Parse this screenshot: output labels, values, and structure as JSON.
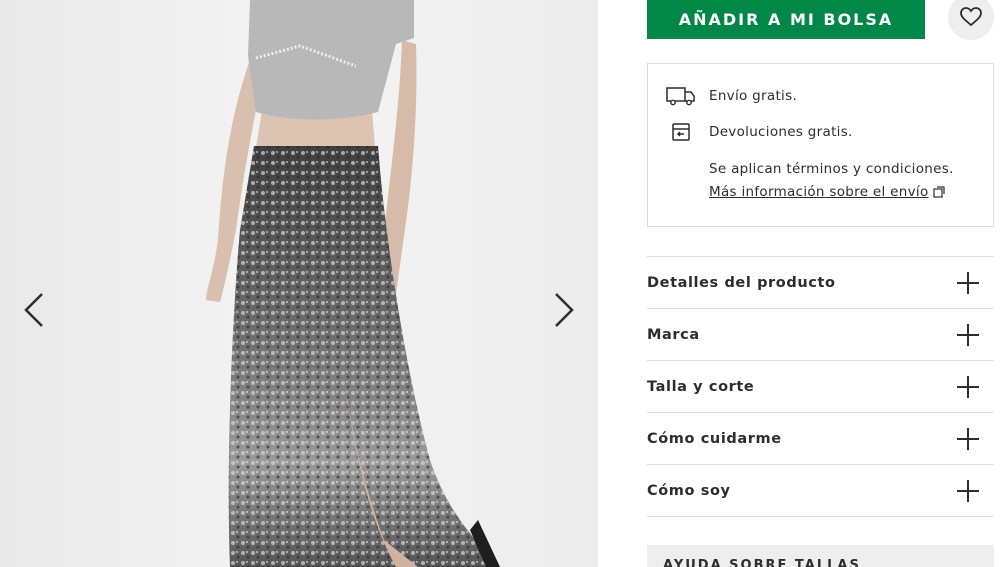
{
  "gallery": {
    "prev_icon": "chevron-left-icon",
    "next_icon": "chevron-right-icon"
  },
  "actions": {
    "add_to_bag_label": "AÑADIR A MI BOLSA",
    "wishlist_icon": "heart-icon",
    "accent_color": "#018849"
  },
  "delivery": {
    "free_shipping": "Envío gratis.",
    "free_returns": "Devoluciones gratis.",
    "terms": "Se aplican términos y condiciones.",
    "more_info_link": "Más información sobre el envío",
    "truck_icon": "truck-icon",
    "returns_icon": "returns-icon",
    "external_icon": "external-link-icon"
  },
  "accordion": [
    {
      "label": "Detalles del producto"
    },
    {
      "label": "Marca"
    },
    {
      "label": "Talla y corte"
    },
    {
      "label": "Cómo cuidarme"
    },
    {
      "label": "Cómo soy"
    }
  ],
  "size_help": {
    "label": "AYUDA SOBRE TALLAS"
  }
}
